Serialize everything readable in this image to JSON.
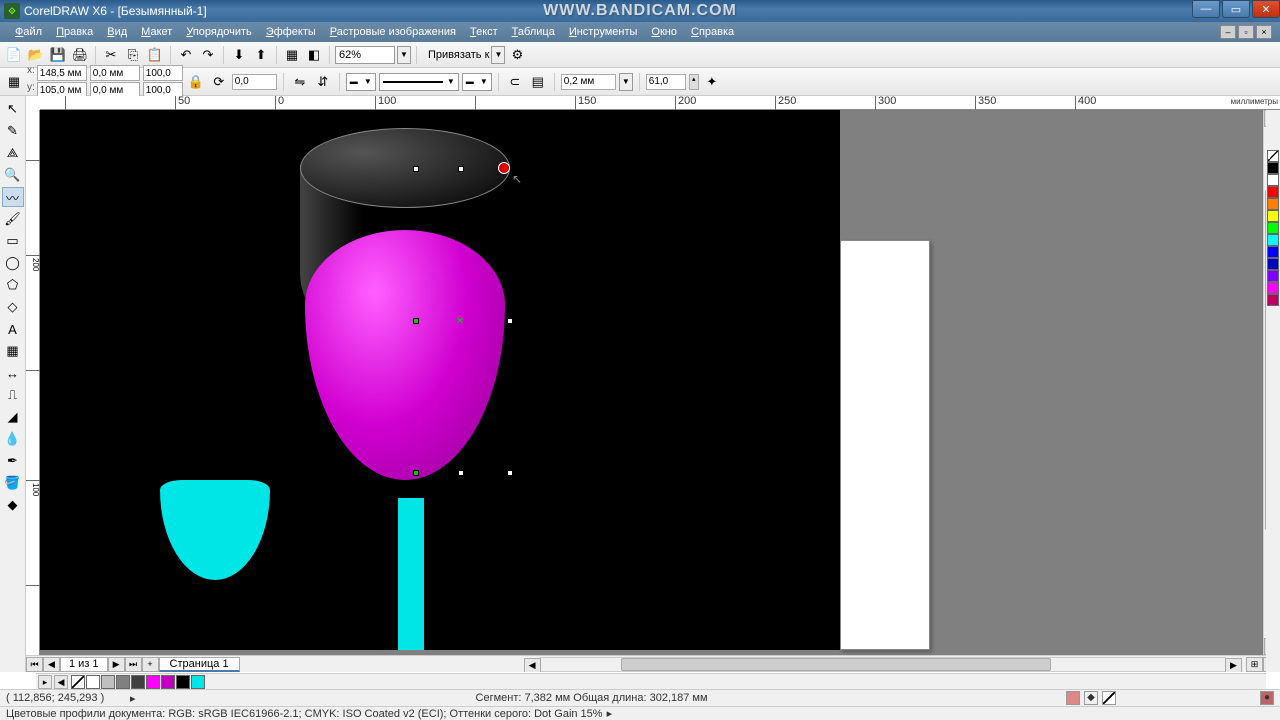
{
  "app": {
    "title": "CorelDRAW X6 - [Безымянный-1]"
  },
  "watermark": "WWW.BANDICAM.COM",
  "menu": [
    "Файл",
    "Правка",
    "Вид",
    "Макет",
    "Упорядочить",
    "Эффекты",
    "Растровые изображения",
    "Текст",
    "Таблица",
    "Инструменты",
    "Окно",
    "Справка"
  ],
  "toolbar": {
    "zoom": "62%",
    "snap": "Привязать к"
  },
  "propbar": {
    "x_label": "x:",
    "x": "148,5 мм",
    "y_label": "y:",
    "y": "105,0 мм",
    "w": "0,0 мм",
    "h": "0,0 мм",
    "sx": "100,0",
    "sy": "100,0",
    "rot": "0,0",
    "outline": "0,2 мм",
    "extra": "61,0"
  },
  "ruler_unit": "миллиметры",
  "ruler_h": [
    {
      "p": 25,
      "v": ""
    },
    {
      "p": 135,
      "v": "50"
    },
    {
      "p": 235,
      "v": "0"
    },
    {
      "p": 335,
      "v": "100"
    },
    {
      "p": 435,
      "v": ""
    },
    {
      "p": 535,
      "v": "150"
    },
    {
      "p": 635,
      "v": "200"
    },
    {
      "p": 735,
      "v": "250"
    },
    {
      "p": 835,
      "v": "300"
    },
    {
      "p": 935,
      "v": "350"
    },
    {
      "p": 1035,
      "v": "400"
    }
  ],
  "ruler_v": [
    {
      "p": 50,
      "v": ""
    },
    {
      "p": 145,
      "v": "200"
    },
    {
      "p": 260,
      "v": ""
    },
    {
      "p": 370,
      "v": "100"
    },
    {
      "p": 475,
      "v": ""
    }
  ],
  "page_nav": {
    "count": "1 из 1",
    "tab": "Страница 1"
  },
  "palette_colors": [
    "#ffffff",
    "#c0c0c0",
    "#808080",
    "#404040",
    "#ff00ff",
    "#c000c0",
    "#000000",
    "#00e5e5"
  ],
  "dock_colors": [
    "#000000",
    "#ffffff",
    "#ff0000",
    "#ff8000",
    "#ffff00",
    "#00ff00",
    "#00ffff",
    "#0000ff",
    "#0000c0",
    "#8000ff",
    "#ff00ff",
    "#c00060"
  ],
  "status": {
    "coords": "( 112,856; 245,293 )",
    "segment": "Сегмент: 7,382 мм Общая длина: 302,187 мм"
  },
  "profile": "Цветовые профили документа: RGB: sRGB IEC61966-2.1; CMYK: ISO Coated v2 (ECI); Оттенки серого: Dot Gain 15%"
}
